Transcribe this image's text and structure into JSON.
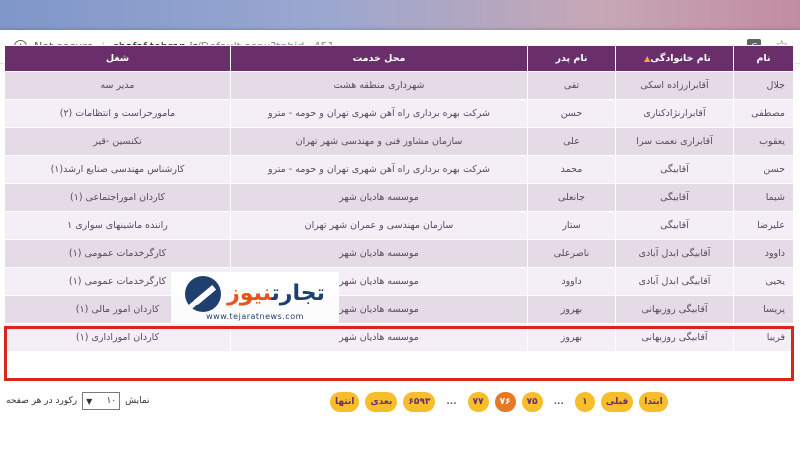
{
  "browser": {
    "security_label": "Not secure",
    "host": "shafaf.tehran.ir",
    "path": "/Default.aspx?tabid=451",
    "translate_icon": "translate-icon",
    "bookmark_icon": "star-icon"
  },
  "table": {
    "headers": [
      "نام",
      "نام خانوادگی",
      "نام پدر",
      "محل خدمت",
      "شغل"
    ],
    "rows": [
      [
        "جلال",
        "آقابرارزاده اسکی",
        "تقی",
        "شهرداری منطقه هشت",
        "مدیر سه"
      ],
      [
        "مصطفی",
        "آقابرارنژادکناری",
        "حسن",
        "شرکت بهره برداری راه آهن شهری تهران و حومه - مترو",
        "مامورحراست و انتظامات (۲)"
      ],
      [
        "یعقوب",
        "آقابراری نعمت سرا",
        "علی",
        "سازمان مشاور فنی و مهندسی شهر تهران",
        "تکنسین -قیر"
      ],
      [
        "حسن",
        "آقابیگی",
        "محمد",
        "شرکت بهره برداری راه آهن شهری تهران و حومه - مترو",
        "کارشناس مهندسی صنایع ارشد(۱)"
      ],
      [
        "شیما",
        "آقابیگی",
        "جانعلی",
        "موسسه هادیان شهر",
        "کاردان اموراجتماعی (۱)"
      ],
      [
        "علیرضا",
        "آقابیگی",
        "ستار",
        "سازمان مهندسی و عمران شهر تهران",
        "راننده ماشینهای سواری ۱"
      ],
      [
        "داوود",
        "آقابیگی ابدل آبادی",
        "ناصرعلی",
        "موسسه هادیان شهر",
        "کارگرخدمات عمومی (۱)"
      ],
      [
        "یحیی",
        "آقابیگی ابدل آبادی",
        "داوود",
        "موسسه هادیان شهر",
        "کارگرخدمات عمومی (۱)"
      ],
      [
        "پریسا",
        "آقابیگی روزبهانی",
        "بهروز",
        "موسسه هادیان شهر",
        "کاردان امور مالی (۱)"
      ],
      [
        "فریبا",
        "آقابیگی روزبهانی",
        "بهروز",
        "موسسه هادیان شهر",
        "کاردان اموراداری (۱)"
      ]
    ]
  },
  "watermark": {
    "brand_part1": "تجارت",
    "brand_part2": "نیوز",
    "url": "www.tejaratnews.com"
  },
  "pager": {
    "buttons": [
      "ابتدا",
      "قبلی",
      "۱",
      "...",
      "۷۵",
      "۷۶",
      "۷۷",
      "...",
      "۶۵۹۳",
      "بعدی",
      "انتها"
    ],
    "active": "۷۶"
  },
  "page_size": {
    "show_label": "نمایش",
    "value": "۱۰",
    "suffix_label": "رکورد در هر صفحه"
  }
}
